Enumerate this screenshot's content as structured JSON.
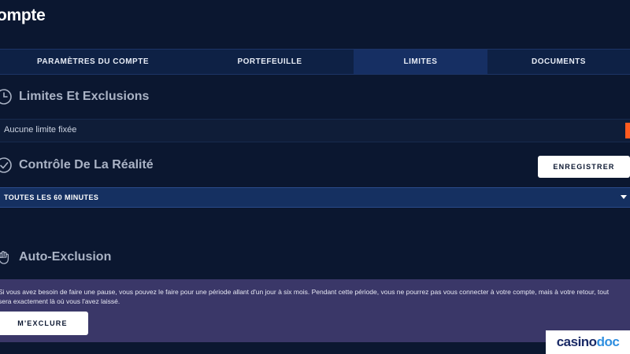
{
  "page": {
    "title": "ompte"
  },
  "tabs": [
    {
      "label": "PARAMÈTRES DU COMPTE",
      "active": false
    },
    {
      "label": "PORTEFEUILLE",
      "active": false
    },
    {
      "label": "LIMITES",
      "active": true
    },
    {
      "label": "DOCUMENTS",
      "active": false
    }
  ],
  "limits": {
    "title": "Limites Et Exclusions",
    "icon": "clock-icon",
    "status_text": "Aucune limite fixée"
  },
  "reality": {
    "title": "Contrôle De La Réalité",
    "icon": "check-circle-icon",
    "save_label": "ENREGISTRER",
    "selected_option": "TOUTES LES 60 MINUTES"
  },
  "self_exclusion": {
    "title": "Auto-Exclusion",
    "icon": "hand-icon",
    "description": "Si vous avez besoin de faire une pause, vous pouvez le faire pour une période allant d'un jour à six mois. Pendant cette période, vous ne pourrez pas vous connecter à votre compte, mais à votre retour, tout sera exactement là où vous l'avez laissé.",
    "button_label": "M'EXCLURE"
  },
  "watermark": {
    "part1": "casino",
    "part2": "doc"
  },
  "colors": {
    "background": "#0b1730",
    "accent": "#ff5b1f",
    "active_tab": "#162f63",
    "panel": "#3a3768"
  }
}
